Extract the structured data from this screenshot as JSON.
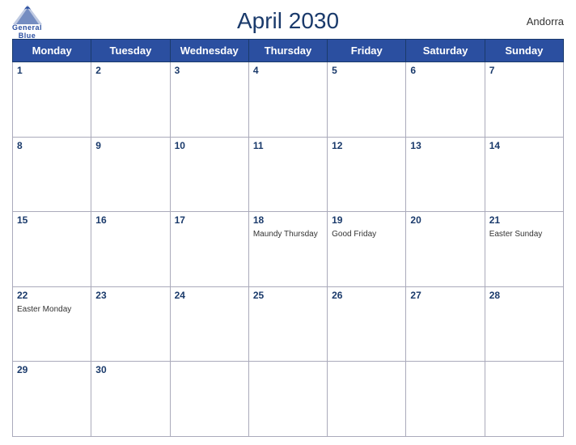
{
  "header": {
    "title": "April 2030",
    "country": "Andorra",
    "logo_top": "General",
    "logo_bottom": "Blue"
  },
  "weekdays": [
    "Monday",
    "Tuesday",
    "Wednesday",
    "Thursday",
    "Friday",
    "Saturday",
    "Sunday"
  ],
  "weeks": [
    [
      {
        "day": "1",
        "holiday": ""
      },
      {
        "day": "2",
        "holiday": ""
      },
      {
        "day": "3",
        "holiday": ""
      },
      {
        "day": "4",
        "holiday": ""
      },
      {
        "day": "5",
        "holiday": ""
      },
      {
        "day": "6",
        "holiday": ""
      },
      {
        "day": "7",
        "holiday": ""
      }
    ],
    [
      {
        "day": "8",
        "holiday": ""
      },
      {
        "day": "9",
        "holiday": ""
      },
      {
        "day": "10",
        "holiday": ""
      },
      {
        "day": "11",
        "holiday": ""
      },
      {
        "day": "12",
        "holiday": ""
      },
      {
        "day": "13",
        "holiday": ""
      },
      {
        "day": "14",
        "holiday": ""
      }
    ],
    [
      {
        "day": "15",
        "holiday": ""
      },
      {
        "day": "16",
        "holiday": ""
      },
      {
        "day": "17",
        "holiday": ""
      },
      {
        "day": "18",
        "holiday": "Maundy Thursday"
      },
      {
        "day": "19",
        "holiday": "Good Friday"
      },
      {
        "day": "20",
        "holiday": ""
      },
      {
        "day": "21",
        "holiday": "Easter Sunday"
      }
    ],
    [
      {
        "day": "22",
        "holiday": "Easter Monday"
      },
      {
        "day": "23",
        "holiday": ""
      },
      {
        "day": "24",
        "holiday": ""
      },
      {
        "day": "25",
        "holiday": ""
      },
      {
        "day": "26",
        "holiday": ""
      },
      {
        "day": "27",
        "holiday": ""
      },
      {
        "day": "28",
        "holiday": ""
      }
    ],
    [
      {
        "day": "29",
        "holiday": ""
      },
      {
        "day": "30",
        "holiday": ""
      },
      {
        "day": "",
        "holiday": ""
      },
      {
        "day": "",
        "holiday": ""
      },
      {
        "day": "",
        "holiday": ""
      },
      {
        "day": "",
        "holiday": ""
      },
      {
        "day": "",
        "holiday": ""
      }
    ]
  ]
}
